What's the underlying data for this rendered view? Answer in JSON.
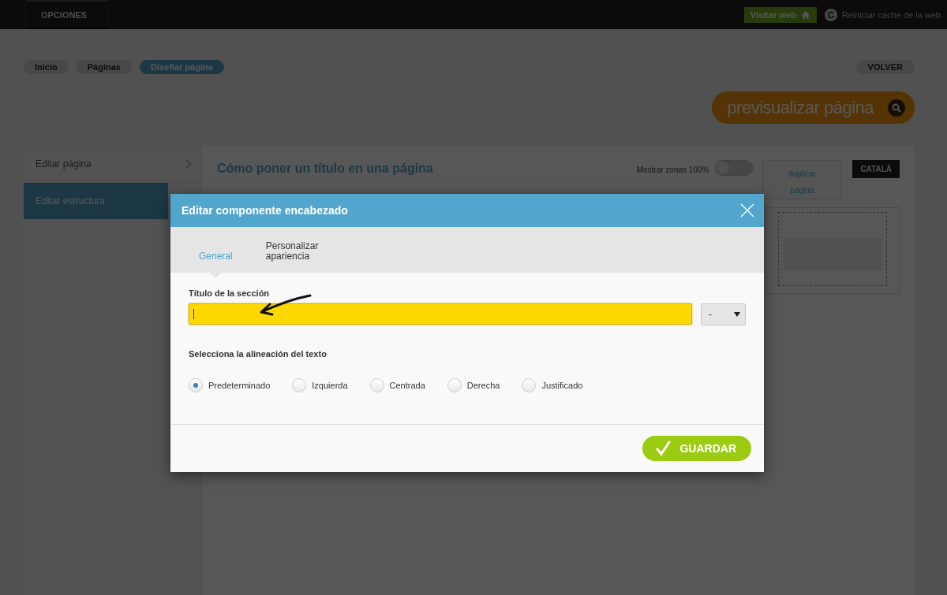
{
  "topbar": {
    "menu_label": "OPCIONES",
    "visit_button": "Visitar web",
    "reset_link": "Reiniciar cache de la web"
  },
  "breadcrumbs": [
    {
      "label": "Inicio",
      "selected": false
    },
    {
      "label": "Páginas",
      "selected": false
    },
    {
      "label": "Diseñar página",
      "selected": true
    }
  ],
  "back_button": "VOLVER",
  "preview_button": "previsualizar página",
  "sidebar": {
    "items": [
      {
        "label": "Editar página",
        "selected": false
      },
      {
        "label": "Editar estructura",
        "selected": true
      }
    ]
  },
  "page": {
    "title": "Cómo poner un título en una página",
    "toggle": {
      "label": "Mostrar zonas 100%",
      "on": false
    },
    "duplicate_button": "duplicar página",
    "language_button": "CATALÀ"
  },
  "modal": {
    "title": "Editar componente encabezado",
    "tabs": [
      {
        "label": "General",
        "selected": true
      },
      {
        "label": "Personalizar apariencia",
        "selected": false
      }
    ],
    "title_field": {
      "label": "Título de la sección",
      "focused": true
    },
    "level_select": {
      "value": "-"
    },
    "alignment": {
      "label": "Selecciona la alineación del texto",
      "options": [
        {
          "label": "Predeterminado",
          "selected": true
        },
        {
          "label": "Izquierda",
          "selected": false
        },
        {
          "label": "Centrada",
          "selected": false
        },
        {
          "label": "Derecha",
          "selected": false
        },
        {
          "label": "Justificado",
          "selected": false
        }
      ]
    },
    "save_button": "GUARDAR"
  }
}
